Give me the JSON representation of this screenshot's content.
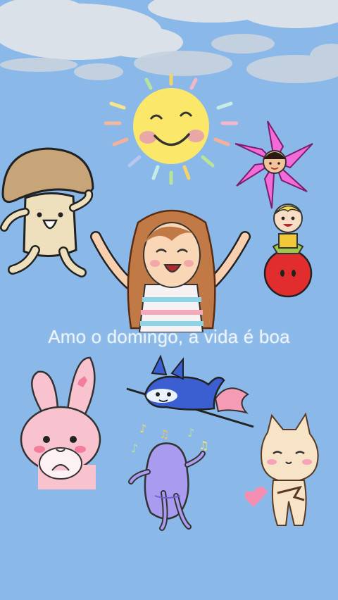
{
  "video": {
    "caption": "Amo o domingo, a vida é boa"
  },
  "stickers": [
    {
      "name": "sun",
      "kind": "smiling-sun"
    },
    {
      "name": "flower",
      "kind": "pink-flower-face"
    },
    {
      "name": "mushroom",
      "kind": "dancing-mushroom"
    },
    {
      "name": "girl",
      "kind": "cheering-girl"
    },
    {
      "name": "boy-on-ball",
      "kind": "boy-on-red-ball"
    },
    {
      "name": "bunny",
      "kind": "pink-bunny"
    },
    {
      "name": "cat",
      "kind": "blue-cat-on-line"
    },
    {
      "name": "purple-blob",
      "kind": "dancing-purple-blob"
    },
    {
      "name": "kitty",
      "kind": "pixel-cream-cat"
    }
  ],
  "colors": {
    "sky": "#8ab9e9",
    "caption": "#ffffff",
    "sun": "#fbe86a",
    "flower": "#f26bd9",
    "ball": "#e12d2d"
  }
}
